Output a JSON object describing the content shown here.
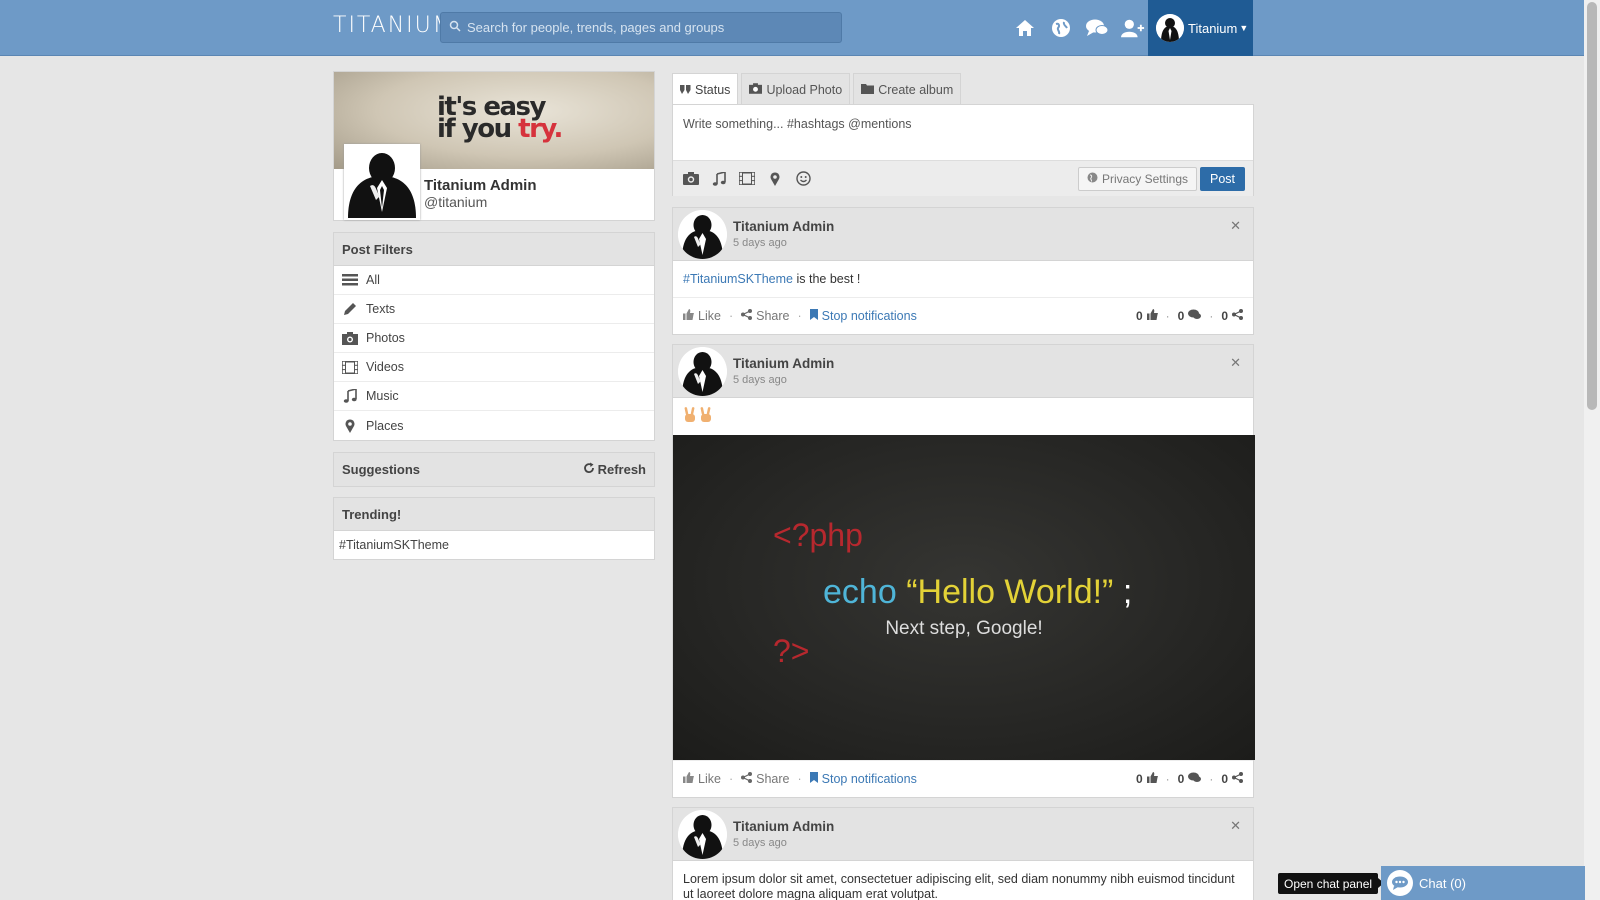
{
  "header": {
    "logo": "TITANIUM",
    "search_placeholder": "Search for people, trends, pages and groups",
    "user_name": "Titanium",
    "icons": [
      "home-icon",
      "globe-icon",
      "messages-icon",
      "add-friend-icon"
    ]
  },
  "profile": {
    "cover_text_line1": "it's easy",
    "cover_text_line2_a": "if you ",
    "cover_text_line2_b": "try.",
    "name": "Titanium Admin",
    "username": "@titanium"
  },
  "post_filters": {
    "title": "Post Filters",
    "items": [
      {
        "label": "All",
        "icon": "list-icon"
      },
      {
        "label": "Texts",
        "icon": "pencil-icon"
      },
      {
        "label": "Photos",
        "icon": "camera-icon"
      },
      {
        "label": "Videos",
        "icon": "film-icon"
      },
      {
        "label": "Music",
        "icon": "music-icon"
      },
      {
        "label": "Places",
        "icon": "map-marker-icon"
      }
    ]
  },
  "suggestions": {
    "title": "Suggestions",
    "refresh": "Refresh"
  },
  "trending": {
    "title": "Trending!",
    "items": [
      "#TitaniumSKTheme"
    ]
  },
  "composer": {
    "tabs": [
      "Status",
      "Upload Photo",
      "Create album"
    ],
    "placeholder": "Write something... #hashtags @mentions",
    "privacy": "Privacy Settings",
    "post": "Post"
  },
  "posts": [
    {
      "author": "Titanium Admin",
      "time": "5 days ago",
      "tag": "#TitaniumSKTheme",
      "text": " is the best !",
      "likes": "0",
      "comments": "0",
      "shares": "0"
    },
    {
      "author": "Titanium Admin",
      "time": "5 days ago",
      "image_line1": "<?php",
      "image_echo": "echo",
      "image_hello": "“Hello World!”",
      "image_semi": ";",
      "image_next": "Next step, Google!",
      "image_close": "?>",
      "likes": "0",
      "comments": "0",
      "shares": "0"
    },
    {
      "author": "Titanium Admin",
      "time": "5 days ago",
      "text": "Lorem ipsum dolor sit amet, consectetuer adipiscing elit, sed diam nonummy nibh euismod tincidunt ut laoreet dolore magna aliquam erat volutpat."
    }
  ],
  "actions": {
    "like": "Like",
    "share": "Share",
    "stop": "Stop notifications"
  },
  "chat": {
    "tooltip": "Open chat panel",
    "label": "Chat (0)"
  },
  "colors": {
    "topbar": "#6e9ac7",
    "user_menu": "#1f5b94",
    "link": "#3c79b5",
    "post_button": "#2d6ca8"
  }
}
